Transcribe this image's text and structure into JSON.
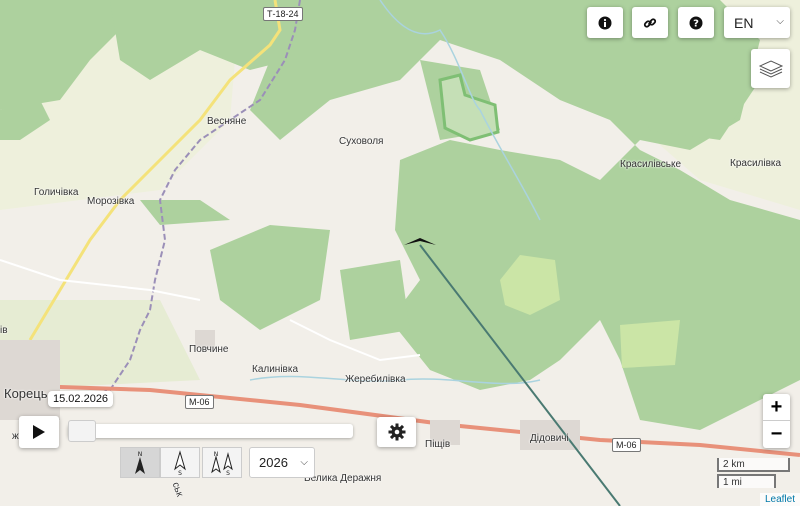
{
  "map": {
    "places": [
      "Т-18-24",
      "Весняне",
      "Суховоля",
      "Голичівка",
      "Морозівка",
      "Красилівське",
      "Красилівка",
      "Повчине",
      "Калинівка",
      "Жеребилівка",
      "Корець",
      "Піщів",
      "Дідовичі",
      "Велика Деражня",
      "M-06",
      "M-06",
      "ж",
      "ів",
      "ськ"
    ],
    "colors": {
      "land": "#f2efe9",
      "forest": "#add19e",
      "track_line": "#4a7a72",
      "road_major": "#e8917a",
      "border": "#9b8fb8"
    }
  },
  "toolbar": {
    "info_icon": "info-icon",
    "link_icon": "link-icon",
    "help_icon": "help-icon",
    "language": "EN",
    "layers_icon": "layers-icon"
  },
  "zoom": {
    "plus": "+",
    "minus": "−"
  },
  "timeline": {
    "date": "15.02.2026",
    "play_icon": "play-icon",
    "settings_icon": "gear-icon",
    "slider_position": 0.0,
    "year": "2026",
    "orientation": [
      {
        "label": "N",
        "active": true
      },
      {
        "label": "S",
        "active": false
      },
      {
        "label": "N S",
        "active": false
      }
    ]
  },
  "scale": {
    "km": "2 km",
    "mi": "1 mi"
  },
  "attribution": "Leaflet"
}
